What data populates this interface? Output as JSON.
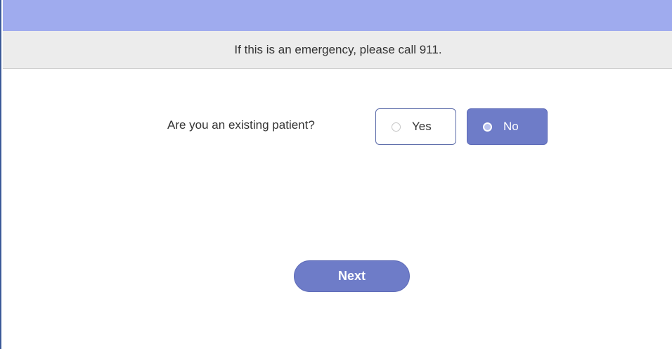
{
  "banner": {
    "text": "If this is an emergency, please call 911."
  },
  "question": {
    "label": "Are you an existing patient?",
    "options": [
      {
        "label": "Yes",
        "selected": false
      },
      {
        "label": "No",
        "selected": true
      }
    ]
  },
  "actions": {
    "next_label": "Next"
  },
  "colors": {
    "header": "#9fabee",
    "accent": "#6e7cc8",
    "banner_bg": "#ececec"
  }
}
